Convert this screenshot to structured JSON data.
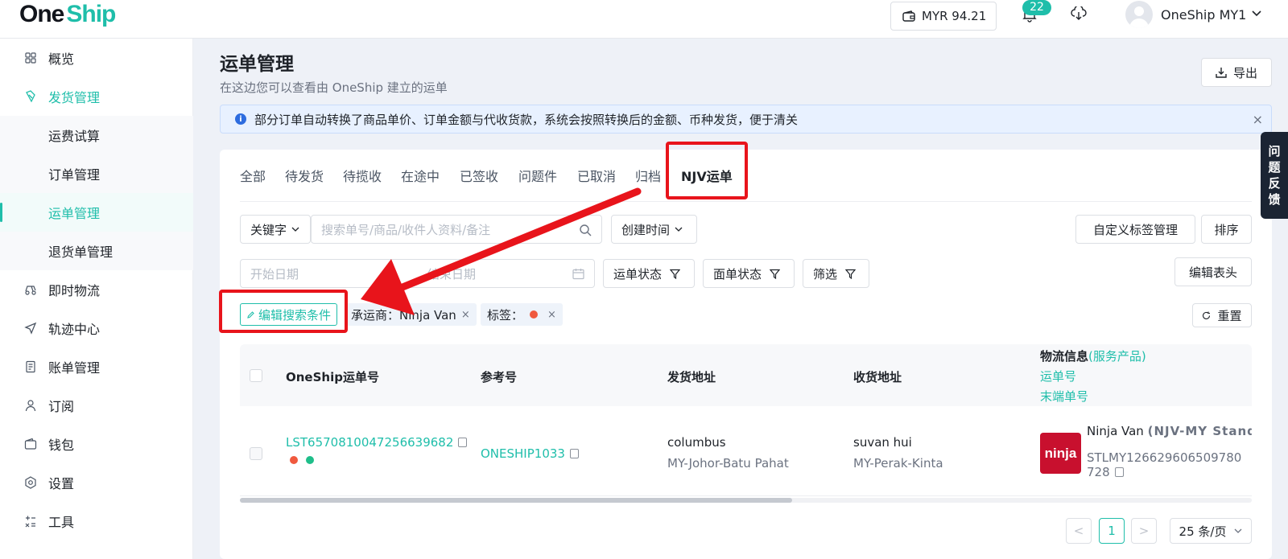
{
  "header": {
    "logo_one": "One",
    "logo_ship": "Ship",
    "balance": "MYR 94.21",
    "notification_count": "22",
    "user_name": "OneShip MY1"
  },
  "sidebar": {
    "items": [
      {
        "label": "概览",
        "icon": "dashboard-icon"
      },
      {
        "label": "发货管理",
        "icon": "shipping-icon"
      },
      {
        "label": "运费试算"
      },
      {
        "label": "订单管理"
      },
      {
        "label": "运单管理"
      },
      {
        "label": "退货单管理"
      },
      {
        "label": "即时物流",
        "icon": "delivery-icon"
      },
      {
        "label": "轨迹中心",
        "icon": "tracking-icon"
      },
      {
        "label": "账单管理",
        "icon": "bill-icon"
      },
      {
        "label": "订阅",
        "icon": "user-icon"
      },
      {
        "label": "钱包",
        "icon": "wallet-icon"
      },
      {
        "label": "设置",
        "icon": "settings-icon"
      },
      {
        "label": "工具",
        "icon": "tools-icon"
      }
    ]
  },
  "page": {
    "title": "运单管理",
    "subtitle": "在这边您可以查看由 OneShip 建立的运单",
    "export_label": "导出",
    "notice": "部分订单自动转换了商品单价、订单金额与代收货款，系统会按照转换后的金额、币种发货，便于清关"
  },
  "tabs": [
    "全部",
    "待发货",
    "待揽收",
    "在途中",
    "已签收",
    "问题件",
    "已取消",
    "归档",
    "NJV运单"
  ],
  "filters": {
    "keyword_label": "关键字",
    "search_placeholder": "搜索单号/商品/收件人资料/备注",
    "created_time": "创建时间",
    "custom_tag_mgmt": "自定义标签管理",
    "sort": "排序",
    "start_date_placeholder": "开始日期",
    "end_date_placeholder": "结束日期",
    "waybill_status": "运单状态",
    "label_status": "面单状态",
    "filter": "筛选",
    "edit_header": "编辑表头",
    "edit_search": "编辑搜索条件",
    "chip_carrier": "承运商：Ninja Van",
    "chip_tag": "标签：",
    "reset": "重置"
  },
  "table": {
    "headers": {
      "waybill_no": "OneShip运单号",
      "reference": "参考号",
      "sender_addr": "发货地址",
      "receiver_addr": "收货地址",
      "logistics": "物流信息",
      "service": "(服务产品)",
      "tracking_no": "运单号",
      "last_mile": "末端单号"
    },
    "rows": [
      {
        "waybill_no": "LST6570810047256639682",
        "reference": "ONESHIP1033",
        "sender_name": "columbus",
        "sender_region": "MY-Johor-Batu Pahat",
        "receiver_name": "suvan hui",
        "receiver_region": "MY-Perak-Kinta",
        "carrier": "Ninja Van",
        "service": "(NJV-MY Standard)",
        "tracking_line1": "STLMY126629606509780",
        "tracking_line2": "728",
        "logo_text": "ninja",
        "tag_colors": [
          "#f0593e",
          "#1fbe8a"
        ]
      }
    ]
  },
  "pagination": {
    "prev": "<",
    "current": "1",
    "next": ">",
    "page_size": "25 条/页"
  },
  "feedback": [
    "问",
    "题",
    "反",
    "馈"
  ],
  "colors": {
    "brand": "#1fbeaa",
    "annotation": "#e8141b",
    "notice_bg": "#e8f1ff"
  }
}
